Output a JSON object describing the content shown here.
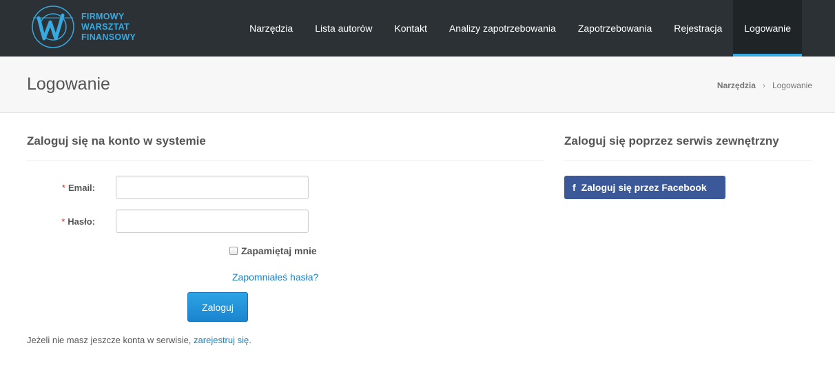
{
  "brand": {
    "lines": [
      "FIRMOWY",
      "WARSZTAT",
      "FINANSOWY"
    ],
    "accent_color": "#36a9e1",
    "logo_icon": "w-circle-logo-icon"
  },
  "nav": {
    "items": [
      {
        "label": "Narzędzia"
      },
      {
        "label": "Lista autorów"
      },
      {
        "label": "Kontakt"
      },
      {
        "label": "Analizy zapotrzebowania"
      },
      {
        "label": "Zapotrzebowania"
      },
      {
        "label": "Rejestracja"
      },
      {
        "label": "Logowanie",
        "active": true
      }
    ]
  },
  "page": {
    "title": "Logowanie",
    "breadcrumb": {
      "link": "Narzędzia",
      "separator": "›",
      "current": "Logowanie"
    }
  },
  "login": {
    "heading": "Zaloguj się na konto w systemie",
    "required_mark": "*",
    "email_label": "Email:",
    "email_value": "",
    "password_label": "Hasło:",
    "password_value": "",
    "remember_label": "Zapamiętaj mnie",
    "remember_checked": false,
    "forgot_link": "Zapomniałeś hasła?",
    "submit_label": "Zaloguj",
    "register_prefix": "Jeżeli nie masz jeszcze konta w serwisie, ",
    "register_link": "zarejestruj się",
    "register_suffix": "."
  },
  "external": {
    "heading": "Zaloguj się poprzez serwis zewnętrzny",
    "facebook_icon": "f",
    "facebook_label": "Zaloguj się przez Facebook",
    "facebook_color": "#3b5998"
  }
}
